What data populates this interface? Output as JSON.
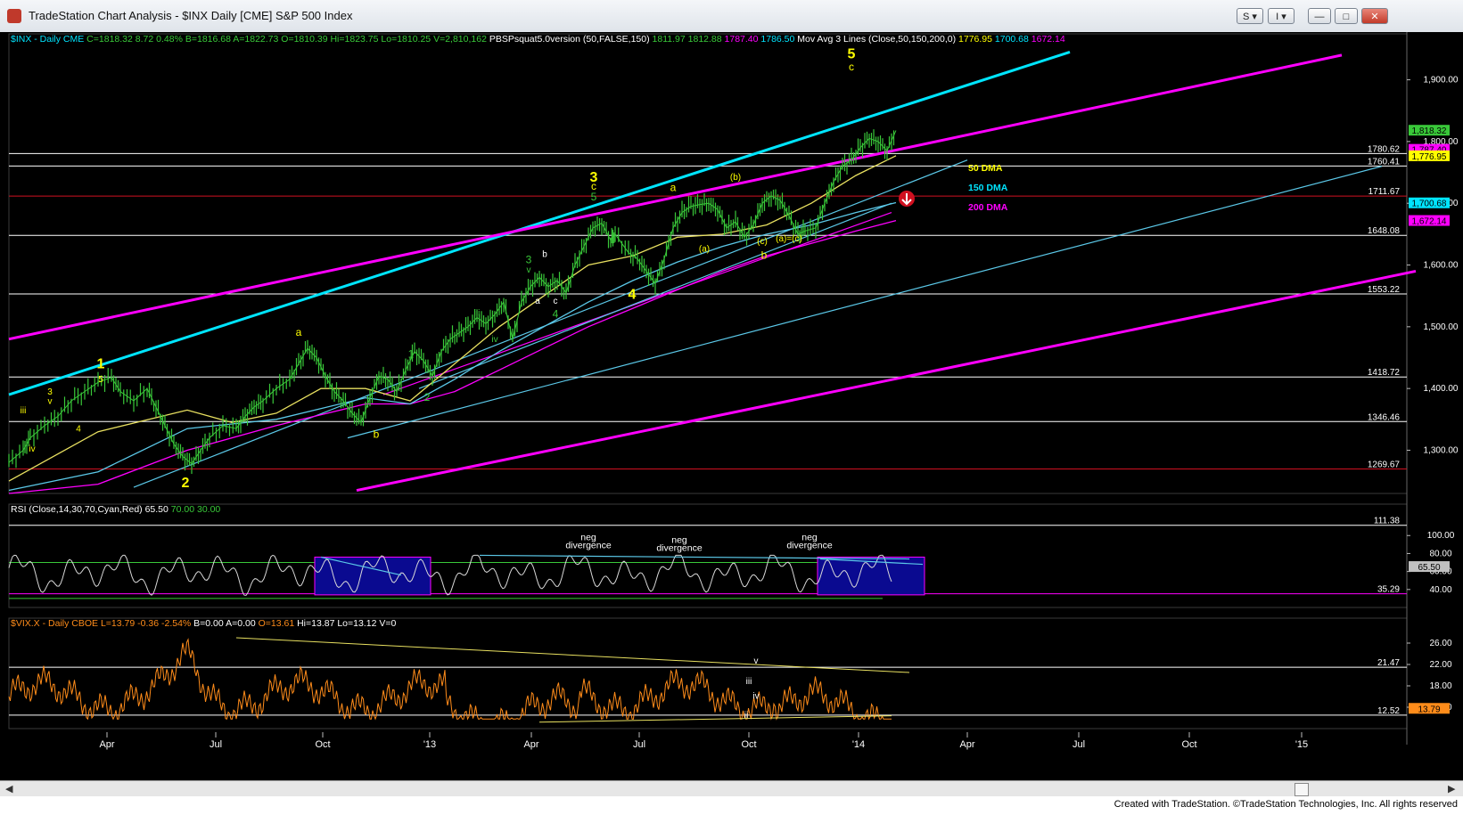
{
  "window": {
    "title": "TradeStation Chart Analysis - $INX Daily [CME] S&P 500 Index",
    "buttons": [
      "S ▾",
      "I ▾",
      "—",
      "□",
      "✕"
    ]
  },
  "footer": {
    "credit": "Created with TradeStation. ©TradeStation Technologies, Inc. All rights reserved"
  },
  "colors": {
    "yellow": "#ffff00",
    "green": "#39c839",
    "magenta": "#ff00ff",
    "cyan": "#00e5ff",
    "lightblue": "#5bc8e8",
    "red": "#d01020",
    "orange": "#ff8c1a",
    "white": "#ffffff"
  },
  "chart_data": [
    {
      "id": "price",
      "type": "line",
      "title": "$INX - Daily  CME",
      "header_items": [
        {
          "text": "$INX - Daily  CME",
          "color": "#00e5ff"
        },
        {
          "text": "C=1818.32",
          "color": "#39c839"
        },
        {
          "text": "8.72",
          "color": "#39c839"
        },
        {
          "text": "0.48%",
          "color": "#39c839"
        },
        {
          "text": "B=1816.68",
          "color": "#39c839"
        },
        {
          "text": "A=1822.73",
          "color": "#39c839"
        },
        {
          "text": "O=1810.39",
          "color": "#39c839"
        },
        {
          "text": "Hi=1823.75",
          "color": "#39c839"
        },
        {
          "text": "Lo=1810.25",
          "color": "#39c839"
        },
        {
          "text": "V=2,810,162",
          "color": "#39c839"
        },
        {
          "text": "PBSPsquat5.0version (50,FALSE,150)",
          "color": "#ffffff"
        },
        {
          "text": "1811.97",
          "color": "#39c839"
        },
        {
          "text": "1812.88",
          "color": "#39c839"
        },
        {
          "text": "1787.40",
          "color": "#ff00ff"
        },
        {
          "text": "1786.50",
          "color": "#00e5ff"
        },
        {
          "text": "Mov Avg 3 Lines (Close,50,150,200,0)",
          "color": "#ffffff"
        },
        {
          "text": "1776.95",
          "color": "#ffff00"
        },
        {
          "text": "1700.68",
          "color": "#00e5ff"
        },
        {
          "text": "1672.14",
          "color": "#ff00ff"
        }
      ],
      "ylim": [
        1230,
        1960
      ],
      "y_ticks": [
        1300,
        1400,
        1500,
        1600,
        1700,
        1800,
        1900
      ],
      "y_tick_labels": [
        "1,300.00",
        "1,400.00",
        "1,500.00",
        "1,600.00",
        "1,700.00",
        "1,800.00",
        "1,900.00"
      ],
      "hlines": [
        {
          "value": 1780.62,
          "label": "1780.62",
          "color": "#ffffff"
        },
        {
          "value": 1760.41,
          "label": "1760.41",
          "color": "#ffffff"
        },
        {
          "value": 1711.67,
          "label": "1711.67",
          "color": "#d01020"
        },
        {
          "value": 1648.08,
          "label": "1648.08",
          "color": "#ffffff"
        },
        {
          "value": 1553.22,
          "label": "1553.22",
          "color": "#ffffff"
        },
        {
          "value": 1418.72,
          "label": "1418.72",
          "color": "#ffffff"
        },
        {
          "value": 1346.46,
          "label": "1346.46",
          "color": "#ffffff"
        },
        {
          "value": 1269.67,
          "label": "1269.67",
          "color": "#d01020"
        }
      ],
      "value_tags": [
        {
          "value": 1818.32,
          "label": "1,818.32",
          "bg": "#39c839",
          "fg": "#000000"
        },
        {
          "value": 1787.4,
          "label": "1,787.40",
          "bg": "#ff00ff",
          "fg": "#000000"
        },
        {
          "value": 1776.95,
          "label": "1,776.95",
          "bg": "#ffff00",
          "fg": "#000000"
        },
        {
          "value": 1700.68,
          "label": "1,700.68",
          "bg": "#00e5ff",
          "fg": "#000000"
        },
        {
          "value": 1672.14,
          "label": "1,672.14",
          "bg": "#ff00ff",
          "fg": "#000000"
        }
      ],
      "close_series": {
        "name": "$INX",
        "x": [
          0,
          16,
          24,
          40,
          55,
          70,
          85,
          100,
          115,
          125,
          140,
          155,
          165,
          175,
          185,
          195,
          205,
          215,
          225,
          240,
          255,
          265,
          275,
          285,
          300,
          315,
          325,
          335,
          345,
          355,
          365,
          375,
          385,
          395,
          405,
          415,
          425,
          435,
          445,
          455,
          465,
          475,
          485,
          495,
          505,
          515,
          525,
          535,
          545,
          555,
          565,
          575,
          585,
          595,
          605,
          615,
          625,
          635,
          645,
          655,
          665,
          675,
          680,
          695,
          705,
          715,
          725,
          735,
          745,
          755,
          765,
          775,
          785,
          795,
          805,
          815,
          825,
          835,
          845,
          855,
          865,
          875,
          885,
          893,
          905,
          915,
          925,
          935,
          945,
          955,
          965,
          975,
          985,
          995
        ],
        "y": [
          1280,
          1300,
          1320,
          1340,
          1355,
          1380,
          1395,
          1410,
          1418,
          1395,
          1380,
          1400,
          1370,
          1340,
          1310,
          1290,
          1278,
          1300,
          1320,
          1340,
          1335,
          1355,
          1370,
          1380,
          1400,
          1415,
          1440,
          1465,
          1450,
          1420,
          1395,
          1380,
          1360,
          1345,
          1385,
          1420,
          1415,
          1395,
          1430,
          1460,
          1445,
          1420,
          1460,
          1480,
          1490,
          1500,
          1515,
          1505,
          1520,
          1540,
          1480,
          1540,
          1565,
          1580,
          1565,
          1575,
          1555,
          1600,
          1630,
          1660,
          1668,
          1640,
          1650,
          1620,
          1610,
          1590,
          1570,
          1610,
          1660,
          1685,
          1695,
          1698,
          1700,
          1690,
          1660,
          1670,
          1645,
          1665,
          1700,
          1712,
          1705,
          1680,
          1650,
          1655,
          1660,
          1700,
          1735,
          1760,
          1770,
          1790,
          1805,
          1800,
          1785,
          1818
        ]
      },
      "ma50": {
        "name": "50 DMA",
        "x": [
          0,
          100,
          200,
          250,
          300,
          350,
          400,
          450,
          500,
          550,
          600,
          650,
          700,
          750,
          800,
          850,
          900,
          950,
          995
        ],
        "y": [
          1250,
          1330,
          1365,
          1345,
          1360,
          1400,
          1400,
          1380,
          1440,
          1500,
          1550,
          1600,
          1615,
          1645,
          1650,
          1665,
          1700,
          1745,
          1777
        ]
      },
      "ma150": {
        "name": "150 DMA",
        "x": [
          0,
          100,
          200,
          300,
          400,
          450,
          500,
          550,
          600,
          650,
          700,
          750,
          800,
          850,
          900,
          950,
          995
        ],
        "y": [
          1235,
          1265,
          1335,
          1350,
          1385,
          1375,
          1415,
          1460,
          1500,
          1540,
          1575,
          1605,
          1630,
          1650,
          1665,
          1685,
          1701
        ]
      },
      "ma200": {
        "name": "200 DMA",
        "x": [
          0,
          100,
          200,
          300,
          400,
          450,
          500,
          550,
          600,
          650,
          700,
          750,
          800,
          850,
          900,
          950,
          995
        ],
        "y": [
          1230,
          1245,
          1300,
          1340,
          1375,
          1375,
          1395,
          1430,
          1465,
          1500,
          1530,
          1560,
          1590,
          1615,
          1635,
          1655,
          1672
        ]
      },
      "ma_legend": [
        {
          "text": "50 DMA",
          "color": "#ffff00"
        },
        {
          "text": "150 DMA",
          "color": "#00e5ff"
        },
        {
          "text": "200 DMA",
          "color": "#ff00ff"
        }
      ],
      "wave_labels": [
        {
          "text": "1",
          "x": 103,
          "y": 1433,
          "color": "#ffff00",
          "size": 16
        },
        {
          "text": "5",
          "x": 103,
          "y": 1410,
          "color": "#ffff00",
          "size": 10
        },
        {
          "text": "3",
          "x": 46,
          "y": 1390,
          "color": "#ffff00",
          "size": 10
        },
        {
          "text": "v",
          "x": 46,
          "y": 1375,
          "color": "#ffff00",
          "size": 10
        },
        {
          "text": "iii",
          "x": 16,
          "y": 1360,
          "color": "#ffff00",
          "size": 10
        },
        {
          "text": "4",
          "x": 78,
          "y": 1330,
          "color": "#ffff00",
          "size": 10
        },
        {
          "text": "iv",
          "x": 26,
          "y": 1298,
          "color": "#ffff00",
          "size": 10
        },
        {
          "text": "2",
          "x": 198,
          "y": 1240,
          "color": "#ffff00",
          "size": 16
        },
        {
          "text": "a",
          "x": 325,
          "y": 1485,
          "color": "#ffff00",
          "size": 12
        },
        {
          "text": "b",
          "x": 412,
          "y": 1320,
          "color": "#ffff00",
          "size": 12
        },
        {
          "text": "1",
          "x": 451,
          "y": 1450,
          "color": "#39c839",
          "size": 12
        },
        {
          "text": "2",
          "x": 469,
          "y": 1380,
          "color": "#39c839",
          "size": 12
        },
        {
          "text": "iii",
          "x": 525,
          "y": 1518,
          "color": "#39c839",
          "size": 10
        },
        {
          "text": "iv",
          "x": 545,
          "y": 1475,
          "color": "#39c839",
          "size": 10
        },
        {
          "text": "3",
          "x": 583,
          "y": 1603,
          "color": "#39c839",
          "size": 12
        },
        {
          "text": "v",
          "x": 583,
          "y": 1588,
          "color": "#39c839",
          "size": 10
        },
        {
          "text": "b",
          "x": 601,
          "y": 1613,
          "color": "#ffffff",
          "size": 10
        },
        {
          "text": "a",
          "x": 593,
          "y": 1537,
          "color": "#ffffff",
          "size": 10
        },
        {
          "text": "c",
          "x": 613,
          "y": 1537,
          "color": "#ffffff",
          "size": 10
        },
        {
          "text": "4",
          "x": 613,
          "y": 1515,
          "color": "#39c839",
          "size": 12
        },
        {
          "text": "3",
          "x": 656,
          "y": 1735,
          "color": "#ffff00",
          "size": 16
        },
        {
          "text": "c",
          "x": 656,
          "y": 1722,
          "color": "#ffff00",
          "size": 12
        },
        {
          "text": "5",
          "x": 656,
          "y": 1705,
          "color": "#39c839",
          "size": 12
        },
        {
          "text": "4",
          "x": 699,
          "y": 1545,
          "color": "#ffff00",
          "size": 16
        },
        {
          "text": "a",
          "x": 745,
          "y": 1720,
          "color": "#ffff00",
          "size": 12
        },
        {
          "text": "(a)",
          "x": 780,
          "y": 1622,
          "color": "#ffff00",
          "size": 10
        },
        {
          "text": "(b)",
          "x": 815,
          "y": 1738,
          "color": "#ffff00",
          "size": 10
        },
        {
          "text": "(c)",
          "x": 845,
          "y": 1634,
          "color": "#ffff00",
          "size": 10
        },
        {
          "text": "(a)=(c)",
          "x": 875,
          "y": 1638,
          "color": "#ffff00",
          "size": 10
        },
        {
          "text": "b",
          "x": 847,
          "y": 1610,
          "color": "#ffff00",
          "size": 12
        },
        {
          "text": "5",
          "x": 945,
          "y": 1935,
          "color": "#ffff00",
          "size": 16
        },
        {
          "text": "c",
          "x": 945,
          "y": 1915,
          "color": "#ffff00",
          "size": 12
        }
      ],
      "x_ticks": [
        {
          "x": 110,
          "label": "Apr"
        },
        {
          "x": 232,
          "label": "Jul"
        },
        {
          "x": 352,
          "label": "Oct"
        },
        {
          "x": 472,
          "label": "'13"
        },
        {
          "x": 586,
          "label": "Apr"
        },
        {
          "x": 707,
          "label": "Jul"
        },
        {
          "x": 830,
          "label": "Oct"
        },
        {
          "x": 953,
          "label": "'14"
        },
        {
          "x": 1075,
          "label": "Apr"
        },
        {
          "x": 1200,
          "label": "Jul"
        },
        {
          "x": 1324,
          "label": "Oct"
        },
        {
          "x": 1450,
          "label": "'15"
        }
      ]
    },
    {
      "id": "rsi",
      "type": "line",
      "title": "RSI (Close,14,30,70,Cyan,Red)",
      "header_items": [
        {
          "text": "RSI (Close,14,30,70,Cyan,Red)",
          "color": "#ffffff"
        },
        {
          "text": "65.50",
          "color": "#ffffff"
        },
        {
          "text": "70.00",
          "color": "#39c839"
        },
        {
          "text": "30.00",
          "color": "#39c839"
        }
      ],
      "ylim": [
        20,
        125
      ],
      "y_ticks": [
        40,
        60,
        80,
        100
      ],
      "y_tick_labels": [
        "40.00",
        "60.00",
        "80.00",
        "100.00"
      ],
      "hlines": [
        {
          "value": 111.38,
          "label": "111.38",
          "color": "#ffffff"
        },
        {
          "value": 35.29,
          "label": "35.29",
          "color": "#ff00ff"
        }
      ],
      "value_tags": [
        {
          "value": 65.5,
          "label": "65.50",
          "bg": "#c0c0c0",
          "fg": "#000000"
        }
      ],
      "annotations": [
        {
          "text": "neg",
          "x": 650,
          "y": 95,
          "color": "#ffffff"
        },
        {
          "text": "divergence",
          "x": 650,
          "y": 86,
          "color": "#ffffff"
        },
        {
          "text": "neg",
          "x": 752,
          "y": 92,
          "color": "#ffffff"
        },
        {
          "text": "divergence",
          "x": 752,
          "y": 83,
          "color": "#ffffff"
        },
        {
          "text": "neg",
          "x": 898,
          "y": 95,
          "color": "#ffffff"
        },
        {
          "text": "divergence",
          "x": 898,
          "y": 86,
          "color": "#ffffff"
        }
      ]
    },
    {
      "id": "vix",
      "type": "line",
      "title": "$VIX.X - Daily  CBOE",
      "header_items": [
        {
          "text": "$VIX.X - Daily  CBOE",
          "color": "#ff8c1a"
        },
        {
          "text": "L=13.79",
          "color": "#ff8c1a"
        },
        {
          "text": "-0.36",
          "color": "#ff8c1a"
        },
        {
          "text": "-2.54%",
          "color": "#ff8c1a"
        },
        {
          "text": "B=0.00",
          "color": "#ffffff"
        },
        {
          "text": "A=0.00",
          "color": "#ffffff"
        },
        {
          "text": "O=13.61",
          "color": "#ff8c1a"
        },
        {
          "text": "Hi=13.87",
          "color": "#ffffff"
        },
        {
          "text": "Lo=13.12",
          "color": "#ffffff"
        },
        {
          "text": "V=0",
          "color": "#ffffff"
        }
      ],
      "ylim": [
        10,
        29
      ],
      "y_ticks": [
        14,
        18,
        22,
        26
      ],
      "y_tick_labels": [
        "14.00",
        "18.00",
        "22.00",
        "26.00"
      ],
      "hlines": [
        {
          "value": 21.47,
          "label": "21.47",
          "color": "#ffffff"
        },
        {
          "value": 12.52,
          "label": "12.52",
          "color": "#ffffff"
        }
      ],
      "value_tags": [
        {
          "value": 13.79,
          "label": "13.79",
          "bg": "#ff8c1a",
          "fg": "#000000"
        }
      ],
      "wave_labels": [
        {
          "text": "v",
          "x": 838,
          "y": 22.2,
          "color": "#ffffff"
        },
        {
          "text": "iii",
          "x": 830,
          "y": 18.3,
          "color": "#ffffff"
        },
        {
          "text": "iv",
          "x": 838,
          "y": 15.6,
          "color": "#ffffff"
        },
        {
          "text": "ii",
          "x": 827,
          "y": 12.0,
          "color": "#ffffff"
        }
      ]
    }
  ]
}
